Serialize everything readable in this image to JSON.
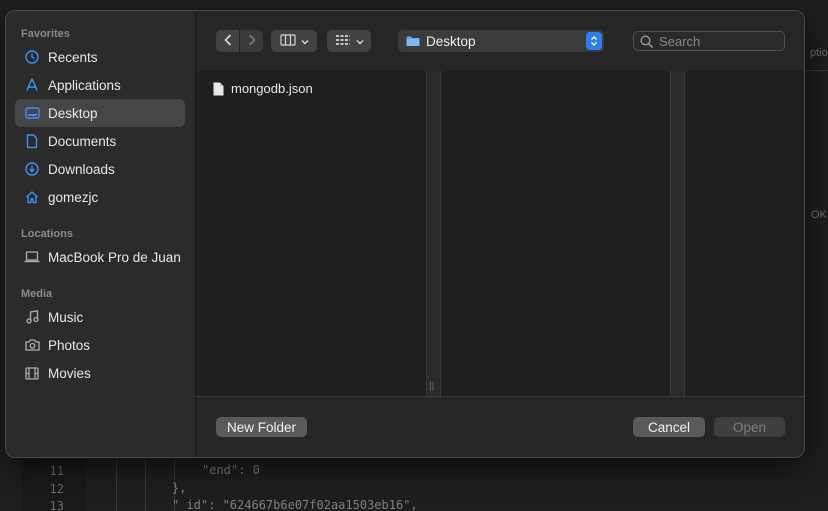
{
  "background": {
    "line_numbers": [
      "11",
      "12",
      "13"
    ],
    "code_lines": [
      "\"end\": 0",
      "},",
      "\"_id\": \"624667b6e07f02aa1503eb16\","
    ],
    "right_fragments": [
      "ptio",
      "OK"
    ]
  },
  "sidebar": {
    "favorites_title": "Favorites",
    "favorites": [
      {
        "label": "Recents",
        "icon": "clock-icon"
      },
      {
        "label": "Applications",
        "icon": "applications-icon"
      },
      {
        "label": "Desktop",
        "icon": "desktop-icon",
        "selected": true
      },
      {
        "label": "Documents",
        "icon": "document-icon"
      },
      {
        "label": "Downloads",
        "icon": "download-icon"
      },
      {
        "label": "gomezjc",
        "icon": "home-icon"
      }
    ],
    "locations_title": "Locations",
    "locations": [
      {
        "label": "MacBook Pro de Juan",
        "icon": "laptop-icon"
      }
    ],
    "media_title": "Media",
    "media": [
      {
        "label": "Music",
        "icon": "music-icon"
      },
      {
        "label": "Photos",
        "icon": "camera-icon"
      },
      {
        "label": "Movies",
        "icon": "film-icon"
      }
    ]
  },
  "toolbar": {
    "path": "Desktop",
    "search_placeholder": "Search"
  },
  "files": [
    {
      "name": "mongodb.json",
      "icon": "file-icon"
    }
  ],
  "buttons": {
    "new_folder": "New Folder",
    "cancel": "Cancel",
    "open": "Open"
  },
  "colors": {
    "accent": "#2f7ef3",
    "selection": "#464646"
  }
}
